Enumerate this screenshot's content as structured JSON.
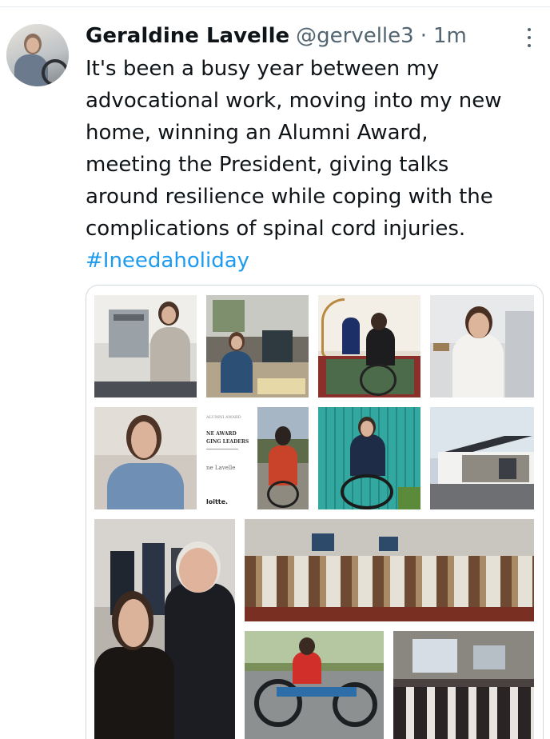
{
  "author": {
    "name": "Geraldine Lavelle",
    "handle": "@gervelle3",
    "separator": "·",
    "time": "1m"
  },
  "tweet": {
    "lines": [
      "It's been a busy year between my",
      "advocational work, moving into my new",
      "home, winning an Alumni Award,",
      "meeting the President, giving talks",
      "around resilience while coping with the",
      "complications of spinal cord injuries."
    ],
    "hashtag": "#Ineedaholiday"
  },
  "media": {
    "document": {
      "line1": "ALUMNI AWARD",
      "line2": "NE AWARD",
      "line3": "GING LEADERS",
      "name": "ne Lavelle",
      "footer": "loitte."
    }
  },
  "icons": {
    "more": "more-options-icon"
  },
  "colors": {
    "link": "#1d9bf0",
    "secondary_text": "#536471",
    "border": "#cfd9de"
  }
}
